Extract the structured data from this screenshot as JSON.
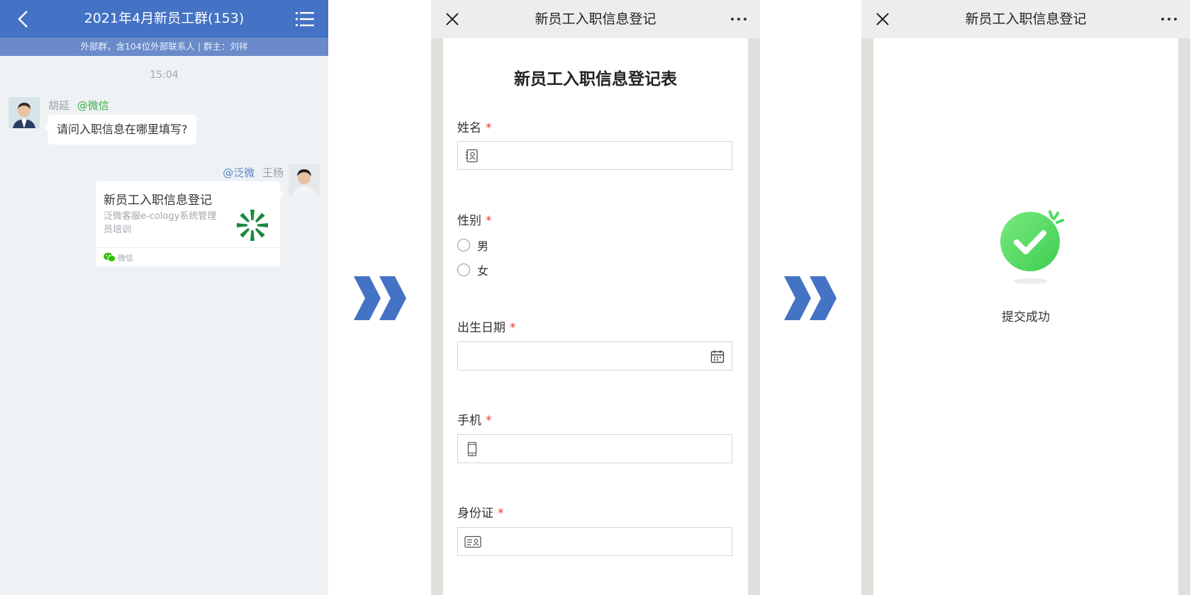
{
  "chat": {
    "header_title": "2021年4月新员工群(153)",
    "subheader": "外部群，含104位外部联系人 | 群主：刘祥",
    "time": "15:04",
    "msg1": {
      "sender": "胡延",
      "mention": "@微信",
      "text": "请问入职信息在哪里填写?"
    },
    "msg2": {
      "mention": "@泛微",
      "sender": "王杨",
      "card_title": "新员工入职信息登记",
      "card_desc": "泛微客服e-cology系统管理员培训",
      "card_source": "微信"
    }
  },
  "form": {
    "header_title": "新员工入职信息登记",
    "title": "新员工入职信息登记表",
    "required_mark": "*",
    "fields": {
      "name": {
        "label": "姓名",
        "icon": "contact-card-icon"
      },
      "gender": {
        "label": "性别",
        "options": [
          "男",
          "女"
        ]
      },
      "birth": {
        "label": "出生日期",
        "icon": "calendar-icon"
      },
      "phone": {
        "label": "手机",
        "icon": "phone-icon"
      },
      "id": {
        "label": "身份证",
        "icon": "id-card-icon"
      }
    }
  },
  "result": {
    "header_title": "新员工入职信息登记",
    "message": "提交成功"
  },
  "colors": {
    "accent": "#4472c4",
    "success": "#4cd964",
    "required": "#e53935"
  }
}
